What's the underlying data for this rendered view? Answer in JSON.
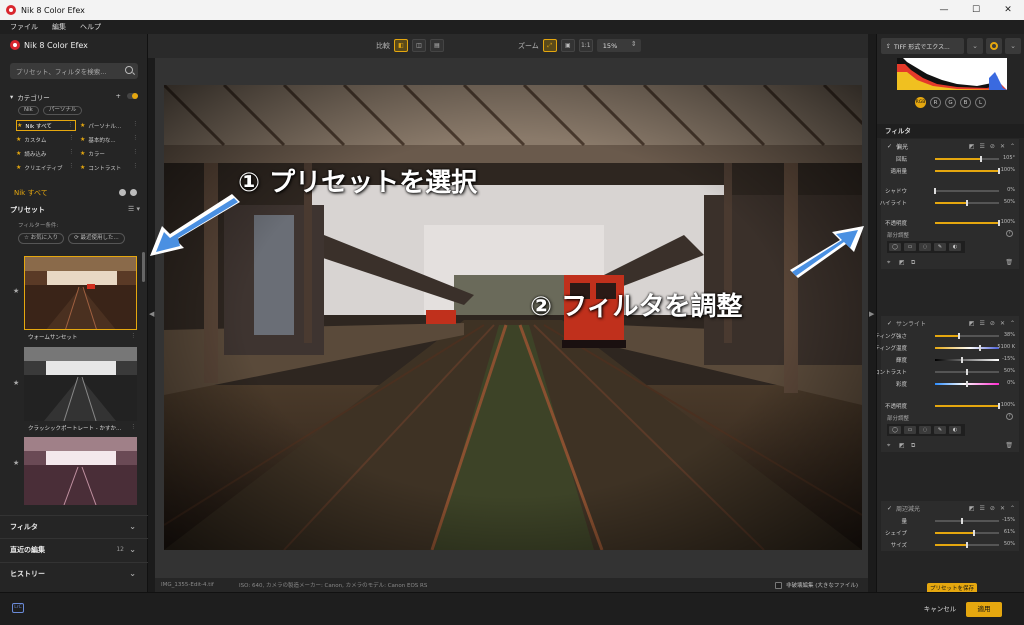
{
  "window": {
    "title": "Nik 8 Color Efex",
    "controls": [
      "—",
      "☐",
      "✕"
    ]
  },
  "menu": [
    "ファイル",
    "編集",
    "ヘルプ"
  ],
  "left": {
    "brand": "Nik 8 Color Efex",
    "search_placeholder": "プリセット、フィルタを検索...",
    "category_label": "カテゴリー",
    "category_pills": [
      "Nik",
      "パーソナル"
    ],
    "categories": [
      {
        "label": "Nik すべて",
        "star": "★",
        "active": true
      },
      {
        "label": "パーソナル...",
        "star": "★",
        "active": false
      },
      {
        "label": "カスタム",
        "star": "★",
        "active": false
      },
      {
        "label": "基本的な...",
        "star": "★",
        "active": false
      },
      {
        "label": "読み込み",
        "star": "★",
        "active": false
      },
      {
        "label": "カラー",
        "star": "★",
        "active": false
      },
      {
        "label": "クリエイティブ",
        "star": "★",
        "active": false
      },
      {
        "label": "コントラスト",
        "star": "★",
        "active": false
      }
    ],
    "current_category": "Nik すべて",
    "preset_header": "プリセット",
    "filter_condition": "フィルター条件:",
    "filter_buttons": [
      "☆ お気に入り",
      "⟳ 最近使用した..."
    ],
    "presets": [
      {
        "label": "ウォームサンセット"
      },
      {
        "label": "クラッシックポートレート - かすか..."
      },
      {
        "label": ""
      }
    ],
    "accordions": [
      {
        "label": "フィルタ",
        "count": ""
      },
      {
        "label": "直近の編集",
        "count": "12"
      },
      {
        "label": "ヒストリー",
        "count": ""
      }
    ]
  },
  "toolbar": {
    "compare_label": "比較",
    "zoom_label": "ズーム",
    "zoom_ratio": "1:1",
    "zoom_value": "15%"
  },
  "annotations": {
    "step1": "① プリセットを選択",
    "step2": "② フィルタを調整"
  },
  "status": {
    "filename": "IMG_1355-Edit-4.tif",
    "metadata": "ISO: 640, カメラの製造メーカー: Canon, カメラのモデル: Canon EOS RS",
    "non_destructive": "非破壊編集 (大きなファイル)"
  },
  "right": {
    "export_label": "TIFF 形式でエクス...",
    "channels": [
      "RGB",
      "R",
      "G",
      "B",
      "L"
    ],
    "section_title": "フィルタ",
    "filters": [
      {
        "name": "偏光",
        "sliders": [
          {
            "label": "回転",
            "value": "105°",
            "level": 0.72
          },
          {
            "label": "適用量",
            "value": "100%",
            "level": 1.0
          },
          {
            "label": "シャドウ",
            "value": "0%",
            "level": 0.0
          },
          {
            "label": "ハイライト",
            "value": "50%",
            "level": 0.5
          },
          {
            "label": "不透明度",
            "value": "100%",
            "level": 1.0
          }
        ]
      },
      {
        "name": "サンライト",
        "sliders": [
          {
            "label": "ライティング強さ",
            "value": "38%",
            "level": 0.38
          },
          {
            "label": "ライティング温度",
            "value": "5100 K",
            "level": 0.7
          },
          {
            "label": "輝度",
            "value": "-15%",
            "level": 0.42
          },
          {
            "label": "コントラスト",
            "value": "50%",
            "level": 0.5
          },
          {
            "label": "彩度",
            "value": "0%",
            "level": 0.5
          },
          {
            "label": "不透明度",
            "value": "100%",
            "level": 1.0
          }
        ]
      },
      {
        "name": "周辺減光",
        "sliders": [
          {
            "label": "量",
            "value": "-15%",
            "level": 0.42
          },
          {
            "label": "シェイプ",
            "value": "61%",
            "level": 0.61
          },
          {
            "label": "サイズ",
            "value": "50%",
            "level": 0.5
          }
        ]
      }
    ],
    "partial_label": "部分調整",
    "save_preset": "プリセットを保存"
  },
  "bottom": {
    "cancel": "キャンセル",
    "apply": "適用",
    "badge": "LrC"
  },
  "colors": {
    "accent": "#e5a70f",
    "brand": "#d9262e",
    "annotation_arrow": "#4a90e2"
  }
}
